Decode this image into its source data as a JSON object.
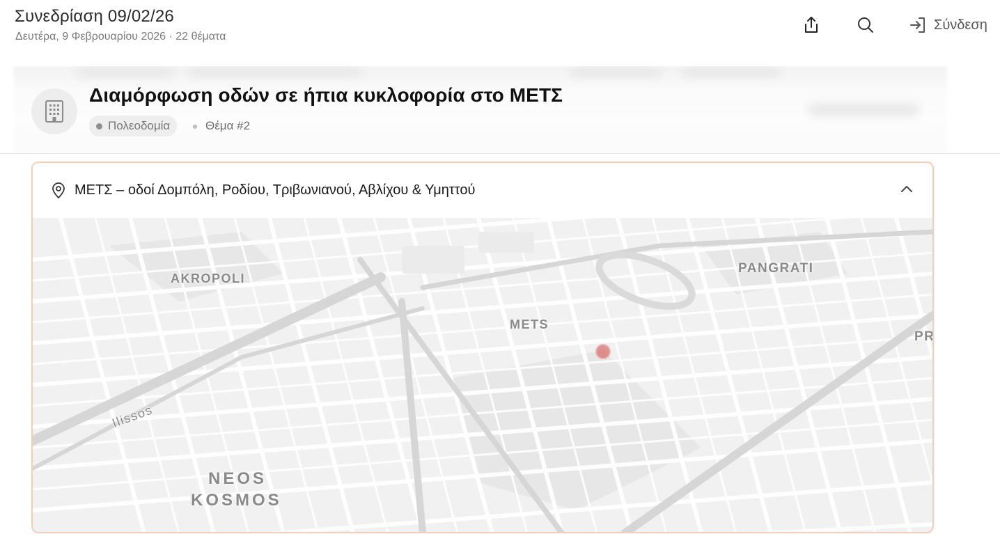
{
  "session": {
    "title": "Συνεδρίαση 09/02/26",
    "subtitle": "Δευτέρα, 9 Φεβρουαρίου 2026 · 22 θέματα"
  },
  "actions": {
    "share_icon": "share-icon",
    "search_icon": "search-icon",
    "login_icon": "login-icon",
    "login_label": "Σύνδεση"
  },
  "topic": {
    "icon": "building-icon",
    "title": "Διαμόρφωση οδών σε ήπια κυκλοφορία στο ΜΕΤΣ",
    "category": "Πολεοδομία",
    "number": "Θέμα #2"
  },
  "location": {
    "icon": "map-pin-icon",
    "text": "ΜΕΤΣ – οδοί Δομπόλη, Ροδίου, Τριβωνιανού, Αβλίχου & Υμηττού",
    "toggle_icon": "chevron-up-icon",
    "map_labels": {
      "akropoli": "AKROPOLI",
      "pangrati": "PANGRATI",
      "mets": "METS",
      "ilissos": "Ilissos",
      "neos": "NEOS",
      "kosmos": "KOSMOS",
      "edge": "PR"
    },
    "marker_color": "#d9706f",
    "accent_border": "#f6cdb7"
  }
}
